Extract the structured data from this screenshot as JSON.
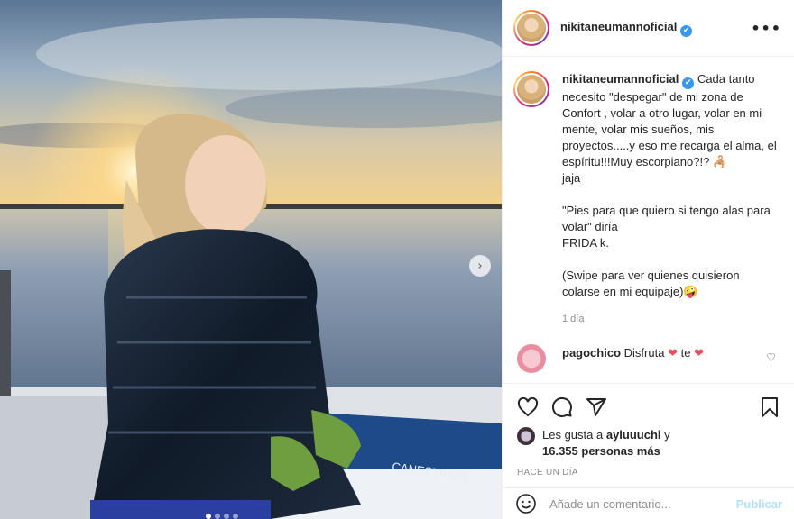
{
  "post": {
    "username": "nikitaneumannoficial",
    "verified_badge": "✔",
    "more_icon": "more-options-icon",
    "next_arrow": "›"
  },
  "caption": {
    "username": "nikitaneumannoficial",
    "text": "Cada tanto necesito \"despegar\" de mi zona de Confort , volar a otro lugar, volar en mi mente, volar mis sueños, mis proyectos.....y eso me recarga el alma, el espíritu!!!Muy escorpiano?!? 🦂\njaja\n\n\"Pies para que quiero si tengo alas para volar\" diría\nFRIDA k.\n\n(Swipe para ver quienes quisieron colarse en mi equipaje)🤪",
    "time": "1 día"
  },
  "comment": {
    "username": "pagochico",
    "text_before": "Disfruta",
    "heart": "❤",
    "text_mid": "te",
    "heart2": "❤",
    "like_icon": "♡"
  },
  "actions": {
    "like": "heart-icon",
    "comment": "comment-icon",
    "share": "share-icon",
    "save": "bookmark-icon"
  },
  "likes": {
    "prefix": "Les gusta a",
    "user": "ayluuuchi",
    "connector": "y",
    "others": "16.355 personas más"
  },
  "post_age": "HACE UN DÍA",
  "add_comment": {
    "placeholder": "Añade un comentario...",
    "publish": "Publicar"
  },
  "colors": {
    "accent_blue": "#3897f0",
    "publish_disabled": "#b2dffc",
    "heart_red": "#ed4956",
    "muted": "#8e8e8e"
  }
}
